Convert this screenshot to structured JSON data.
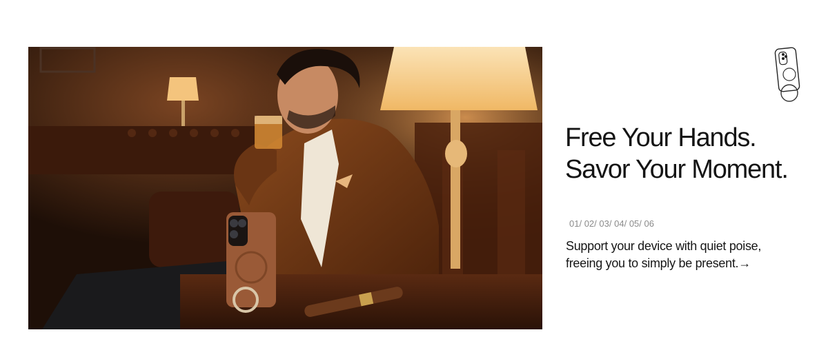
{
  "hero": {
    "image": "man-in-lounge-with-phone-case-photo"
  },
  "product_thumbnail": {
    "icon": "phone-case-ring-icon"
  },
  "headline": {
    "line1": "Free Your Hands.",
    "line2": "Savor Your Moment."
  },
  "pager": {
    "items": [
      "01/",
      "02/",
      "03/",
      "04/",
      "05/",
      "06"
    ],
    "active_index": 0
  },
  "description": {
    "line1": "Support your device with quiet poise,",
    "line2": "freeing you to simply be present.",
    "arrow": "→"
  },
  "colors": {
    "headline": "#141414",
    "pager": "#8a8a8a",
    "photo_dark": "#2a160b",
    "lamp_glow": "#f6c98a",
    "jacket": "#7a3f17",
    "case": "#9a5a37"
  }
}
